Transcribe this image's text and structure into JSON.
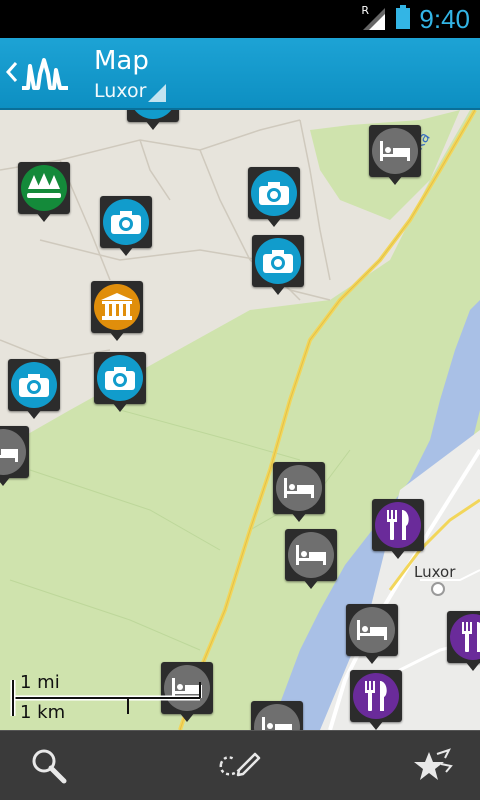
{
  "status_bar": {
    "time": "9:40",
    "roaming_indicator": "R",
    "icons": [
      "signal-icon",
      "battery-icon"
    ],
    "accent_color": "#33b5e5"
  },
  "action_bar": {
    "title": "Map",
    "subtitle": "Luxor",
    "background_color": "#1da3d5",
    "icons": [
      "up-caret-icon",
      "app-logo-icon"
    ]
  },
  "map": {
    "town_label": "Luxor",
    "road_label": "Toshka",
    "scale": {
      "miles_label": "1 mi",
      "km_label": "1 km"
    },
    "pins": [
      {
        "type": "camera",
        "icon": "camera-icon"
      },
      {
        "type": "forest",
        "icon": "tree-icon"
      },
      {
        "type": "camera",
        "icon": "camera-icon"
      },
      {
        "type": "camera",
        "icon": "camera-icon"
      },
      {
        "type": "hotel",
        "icon": "bed-icon"
      },
      {
        "type": "camera",
        "icon": "camera-icon"
      },
      {
        "type": "museum",
        "icon": "museum-icon"
      },
      {
        "type": "camera",
        "icon": "camera-icon"
      },
      {
        "type": "camera",
        "icon": "camera-icon"
      },
      {
        "type": "hotel",
        "icon": "bed-icon"
      },
      {
        "type": "hotel",
        "icon": "bed-icon"
      },
      {
        "type": "food",
        "icon": "cutlery-icon"
      },
      {
        "type": "hotel",
        "icon": "bed-icon"
      },
      {
        "type": "hotel",
        "icon": "bed-icon"
      },
      {
        "type": "food",
        "icon": "cutlery-icon"
      },
      {
        "type": "food",
        "icon": "cutlery-icon"
      },
      {
        "type": "hotel",
        "icon": "bed-icon"
      },
      {
        "type": "hotel",
        "icon": "bed-icon"
      }
    ],
    "colors": {
      "camera": "#119ccc",
      "hotel": "#6f6f6f",
      "forest": "#148a3a",
      "museum": "#e08e0b",
      "food": "#6a2b9a",
      "river": "#a9c0e6",
      "green_area": "#cfe3ad",
      "road": "#f2d65a"
    }
  },
  "toolbar": {
    "buttons": [
      {
        "icon": "search-icon"
      },
      {
        "icon": "draw-route-icon"
      },
      {
        "icon": "favorites-icon"
      }
    ],
    "background_color": "#3a3a3a"
  }
}
